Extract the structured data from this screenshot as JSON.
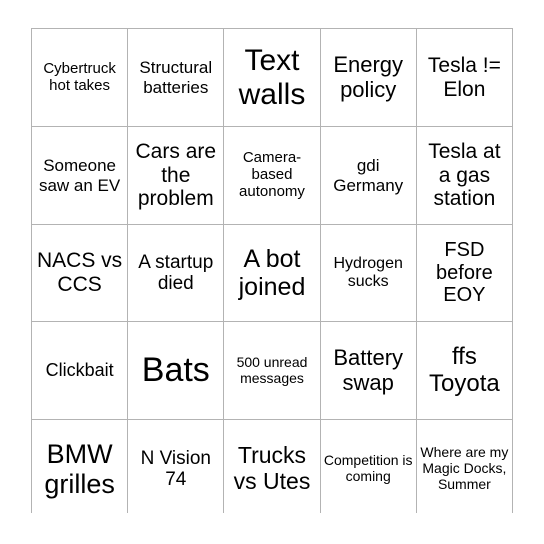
{
  "card": {
    "type": "bingo-card",
    "columns": 5,
    "rows": 5,
    "border_color": "#b3b3b3",
    "cell_background": "#ffffff",
    "text_color": "#000000",
    "cells": [
      {
        "text": "Cybertruck hot takes",
        "size": "fs-15"
      },
      {
        "text": "Structural batteries",
        "size": "fs-17"
      },
      {
        "text": "Text walls",
        "size": "fs-30"
      },
      {
        "text": "Energy policy",
        "size": "fs-22"
      },
      {
        "text": "Tesla != Elon",
        "size": "fs-21"
      },
      {
        "text": "Someone saw an EV",
        "size": "fs-17"
      },
      {
        "text": "Cars are the problem",
        "size": "fs-21"
      },
      {
        "text": "Camera-based autonomy",
        "size": "fs-15"
      },
      {
        "text": "gdi Germany",
        "size": "fs-17"
      },
      {
        "text": "Tesla at a gas station",
        "size": "fs-21"
      },
      {
        "text": "NACS vs CCS",
        "size": "fs-21"
      },
      {
        "text": "A startup died",
        "size": "fs-19"
      },
      {
        "text": "A bot joined",
        "size": "fs-25"
      },
      {
        "text": "Hydrogen sucks",
        "size": "fs-16"
      },
      {
        "text": "FSD before EOY",
        "size": "fs-20"
      },
      {
        "text": "Clickbait",
        "size": "fs-18"
      },
      {
        "text": "Bats",
        "size": "fs-34"
      },
      {
        "text": "500 unread messages",
        "size": "fs-14"
      },
      {
        "text": "Battery swap",
        "size": "fs-22"
      },
      {
        "text": "ffs Toyota",
        "size": "fs-24"
      },
      {
        "text": "BMW grilles",
        "size": "fs-27"
      },
      {
        "text": "N Vision 74",
        "size": "fs-19"
      },
      {
        "text": "Trucks vs Utes",
        "size": "fs-23"
      },
      {
        "text": "Competition is coming",
        "size": "fs-14"
      },
      {
        "text": "Where are my Magic Docks, Summer",
        "size": "fs-14"
      }
    ]
  }
}
